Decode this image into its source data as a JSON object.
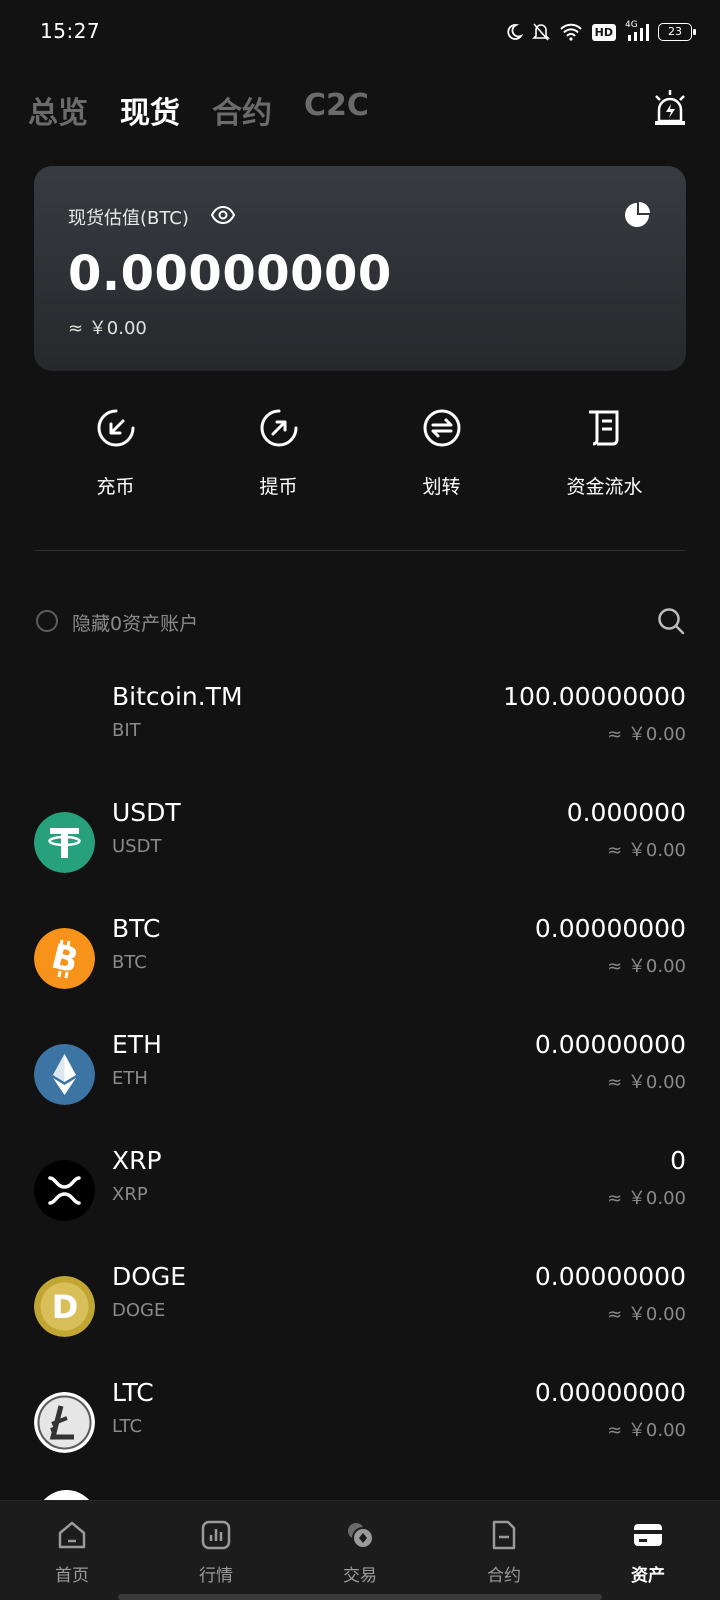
{
  "status_bar": {
    "time": "15:27",
    "battery": "23",
    "network": "4G",
    "hd": "HD"
  },
  "top_tabs": [
    {
      "label": "总览",
      "active": false
    },
    {
      "label": "现货",
      "active": true
    },
    {
      "label": "合约",
      "active": false
    },
    {
      "label": "C2C",
      "active": false
    }
  ],
  "summary_card": {
    "label": "现货估值(BTC)",
    "value": "0.00000000",
    "fiat": "≈ ￥0.00"
  },
  "actions": [
    {
      "label": "充币",
      "icon": "deposit-icon"
    },
    {
      "label": "提币",
      "icon": "withdraw-icon"
    },
    {
      "label": "划转",
      "icon": "transfer-icon"
    },
    {
      "label": "资金流水",
      "icon": "ledger-icon"
    }
  ],
  "filter": {
    "label": "隐藏0资产账户"
  },
  "assets": [
    {
      "name": "Bitcoin.TM",
      "symbol": "BIT",
      "amount": "100.00000000",
      "fiat": "≈ ￥0.00"
    },
    {
      "name": "USDT",
      "symbol": "USDT",
      "amount": "0.000000",
      "fiat": "≈ ￥0.00"
    },
    {
      "name": "BTC",
      "symbol": "BTC",
      "amount": "0.00000000",
      "fiat": "≈ ￥0.00"
    },
    {
      "name": "ETH",
      "symbol": "ETH",
      "amount": "0.00000000",
      "fiat": "≈ ￥0.00"
    },
    {
      "name": "XRP",
      "symbol": "XRP",
      "amount": "0",
      "fiat": "≈ ￥0.00"
    },
    {
      "name": "DOGE",
      "symbol": "DOGE",
      "amount": "0.00000000",
      "fiat": "≈ ￥0.00"
    },
    {
      "name": "LTC",
      "symbol": "LTC",
      "amount": "0.00000000",
      "fiat": "≈ ￥0.00"
    }
  ],
  "colors": {
    "usdt": "#26a17b",
    "btc": "#f7931a",
    "eth": "#3c75a3",
    "doge": "#c2a633",
    "background": "#121212"
  },
  "bottom_nav": [
    {
      "label": "首页",
      "active": false
    },
    {
      "label": "行情",
      "active": false
    },
    {
      "label": "交易",
      "active": false
    },
    {
      "label": "合约",
      "active": false
    },
    {
      "label": "资产",
      "active": true
    }
  ]
}
